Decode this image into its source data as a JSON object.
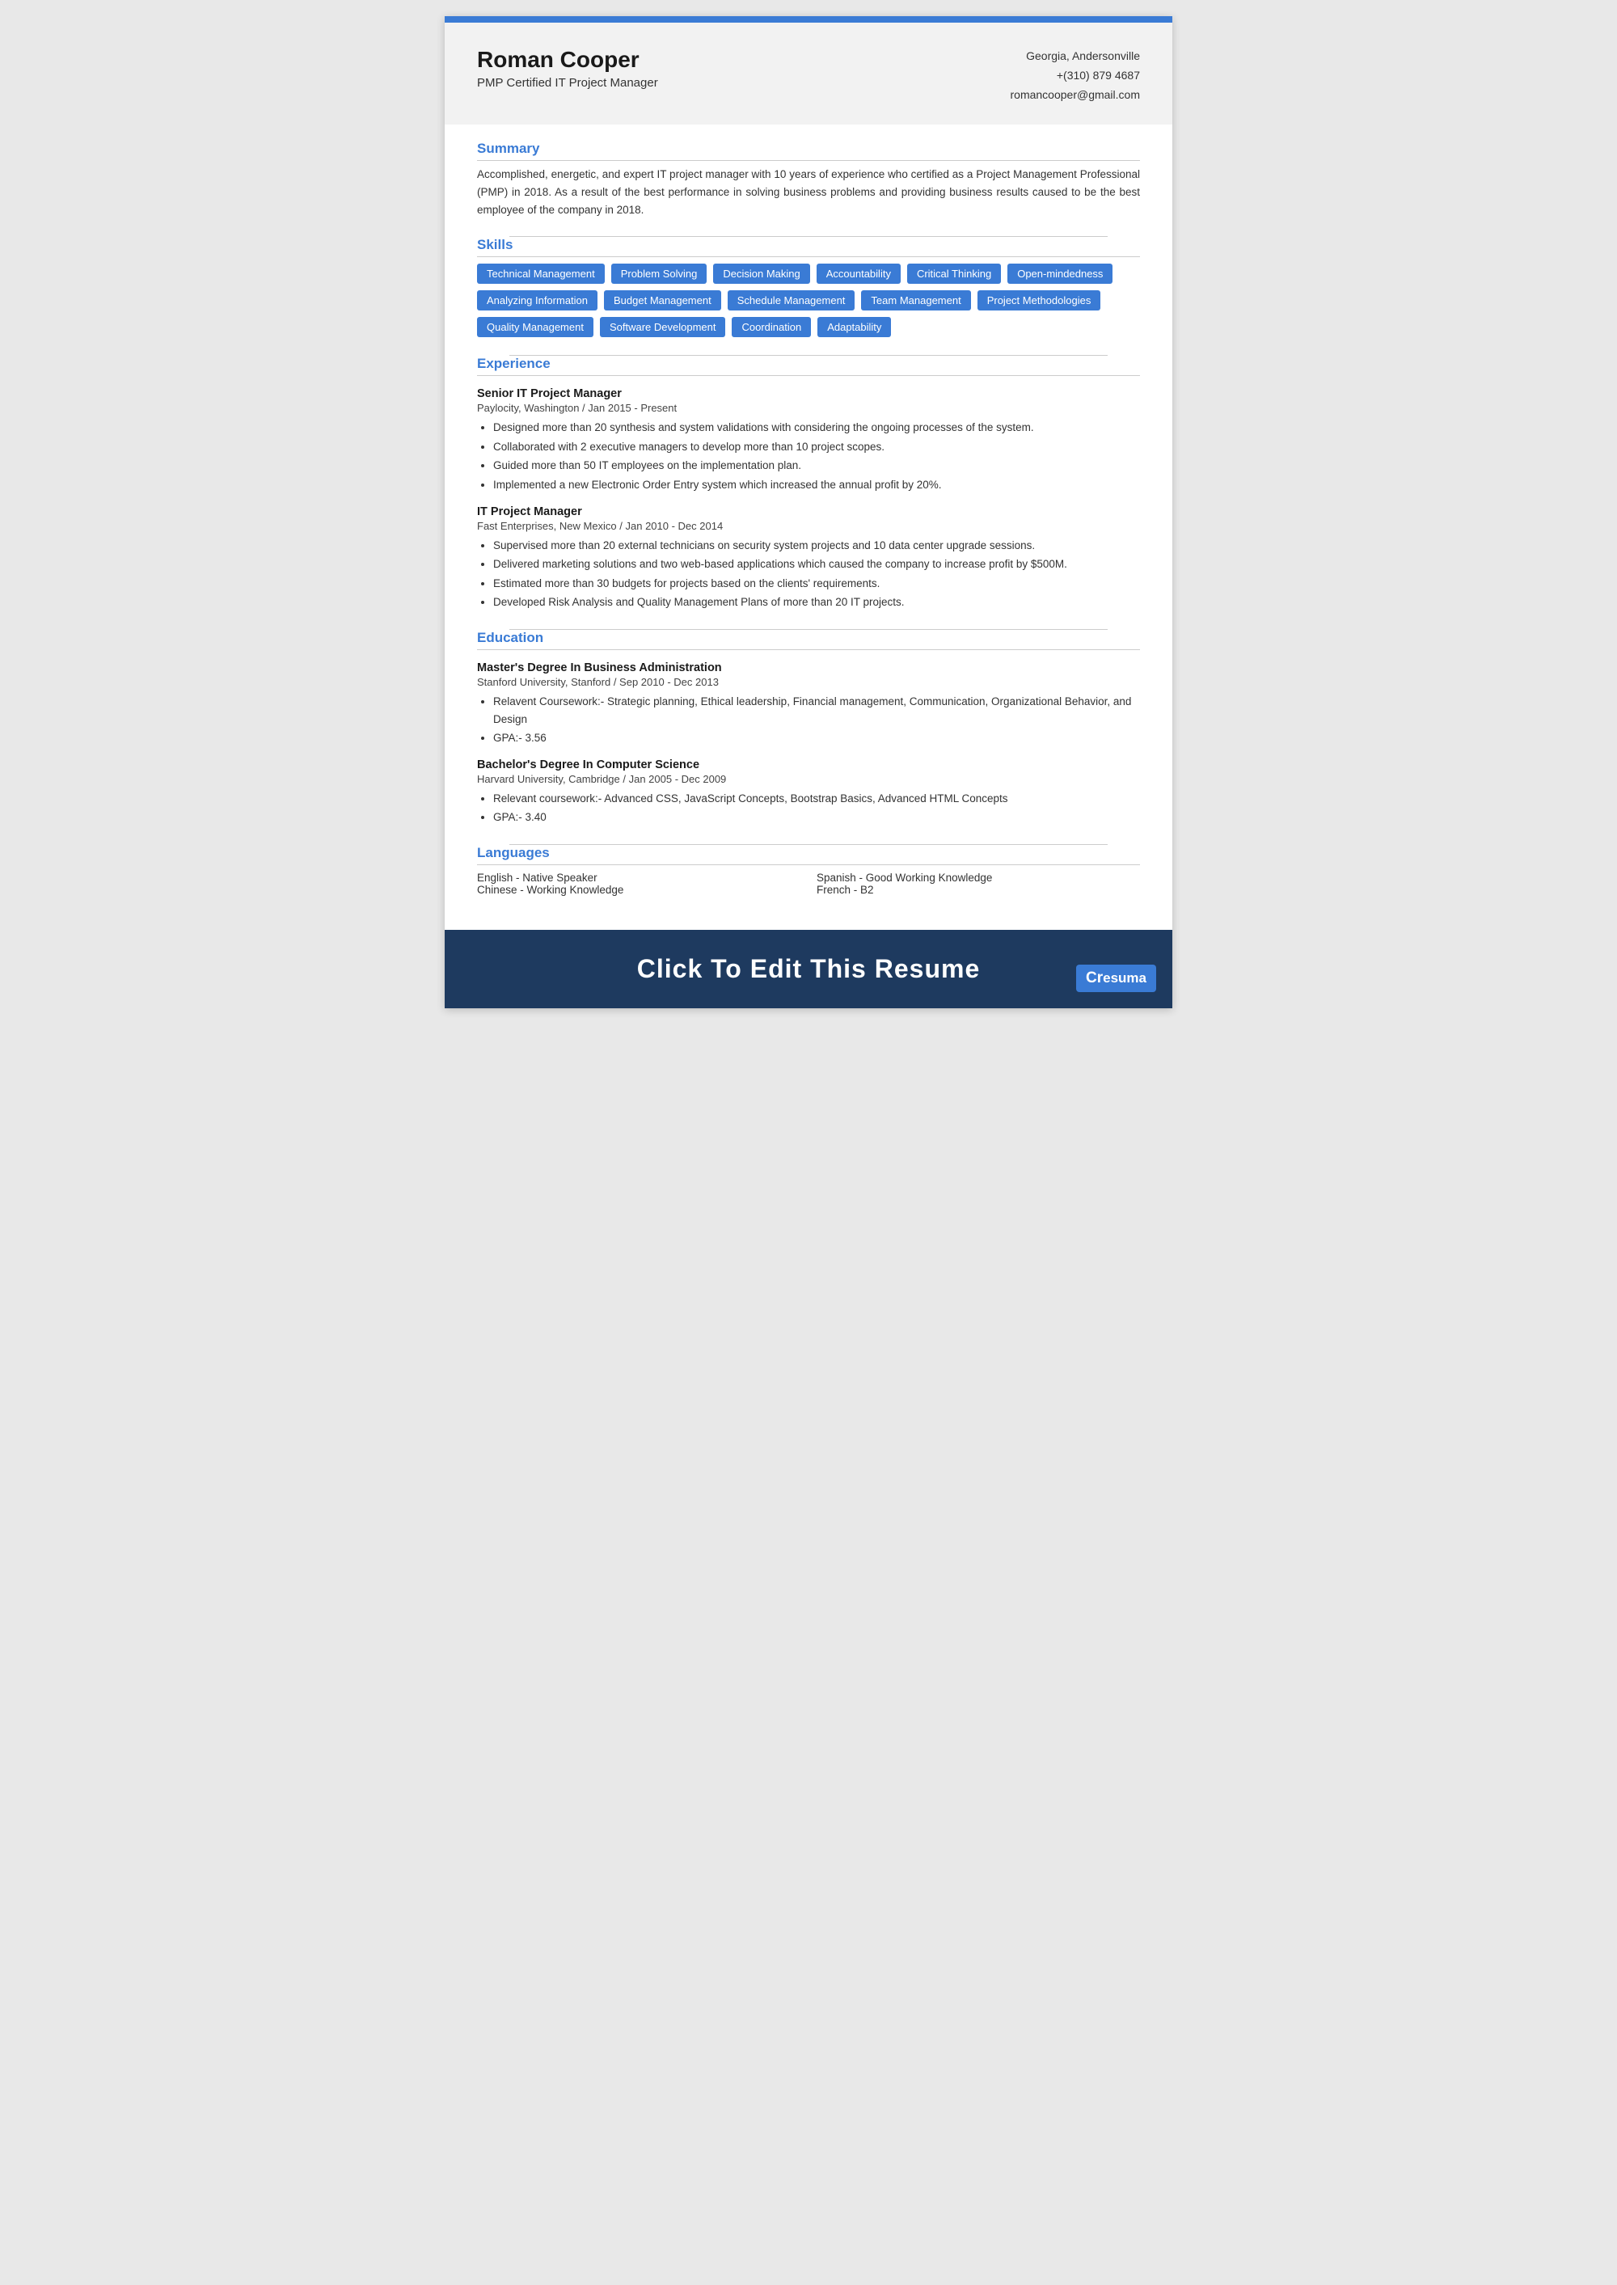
{
  "topBar": {},
  "header": {
    "name": "Roman Cooper",
    "title": "PMP Certified IT Project Manager",
    "location": "Georgia, Andersonville",
    "phone": "+(310) 879 4687",
    "email": "romancooper@gmail.com"
  },
  "sections": {
    "summary": {
      "title": "Summary",
      "text": "Accomplished, energetic, and expert IT project manager with 10 years of experience who certified as a Project Management Professional (PMP) in 2018. As a result of the best performance in solving business problems and providing business results caused to be the best employee of the company in 2018."
    },
    "skills": {
      "title": "Skills",
      "items": [
        "Technical Management",
        "Problem Solving",
        "Decision Making",
        "Accountability",
        "Critical Thinking",
        "Open-mindedness",
        "Analyzing Information",
        "Budget Management",
        "Schedule Management",
        "Team Management",
        "Project Methodologies",
        "Quality Management",
        "Software Development",
        "Coordination",
        "Adaptability"
      ]
    },
    "experience": {
      "title": "Experience",
      "jobs": [
        {
          "title": "Senior IT Project Manager",
          "company": "Paylocity, Washington / Jan 2015 - Present",
          "bullets": [
            "Designed more than 20 synthesis and system validations with considering the ongoing processes of the system.",
            "Collaborated with 2 executive managers to develop more than 10 project scopes.",
            "Guided more than 50 IT employees on the implementation plan.",
            "Implemented a new Electronic Order Entry system which increased the annual profit by 20%."
          ]
        },
        {
          "title": "IT Project Manager",
          "company": "Fast Enterprises, New Mexico / Jan 2010 - Dec 2014",
          "bullets": [
            "Supervised more than 20 external technicians on security system projects and 10 data center upgrade sessions.",
            "Delivered marketing solutions and two web-based applications which caused the company to increase profit by $500M.",
            "Estimated more than 30 budgets for projects based on the clients' requirements.",
            "Developed Risk Analysis and Quality Management Plans of more than 20 IT projects."
          ]
        }
      ]
    },
    "education": {
      "title": "Education",
      "degrees": [
        {
          "degree": "Master's Degree In Business Administration",
          "school": "Stanford University, Stanford / Sep 2010 - Dec 2013",
          "bullets": [
            "Relavent Coursework:- Strategic planning, Ethical leadership, Financial management, Communication, Organizational Behavior, and Design",
            "GPA:- 3.56"
          ]
        },
        {
          "degree": "Bachelor's Degree In Computer Science",
          "school": "Harvard University, Cambridge / Jan 2005 - Dec 2009",
          "bullets": [
            "Relevant coursework:- Advanced CSS, JavaScript Concepts,  Bootstrap Basics, Advanced HTML Concepts",
            "GPA:- 3.40"
          ]
        }
      ]
    },
    "languages": {
      "title": "Languages",
      "items": [
        {
          "lang": "English - Native Speaker",
          "col": 1
        },
        {
          "lang": "Spanish - Good Working Knowledge",
          "col": 2
        },
        {
          "lang": "Chinese - Working Knowledge",
          "col": 1
        },
        {
          "lang": "French - B2",
          "col": 2
        }
      ]
    }
  },
  "footer": {
    "cta": "Click To Edit This Resume",
    "logo": "Cresuma"
  }
}
